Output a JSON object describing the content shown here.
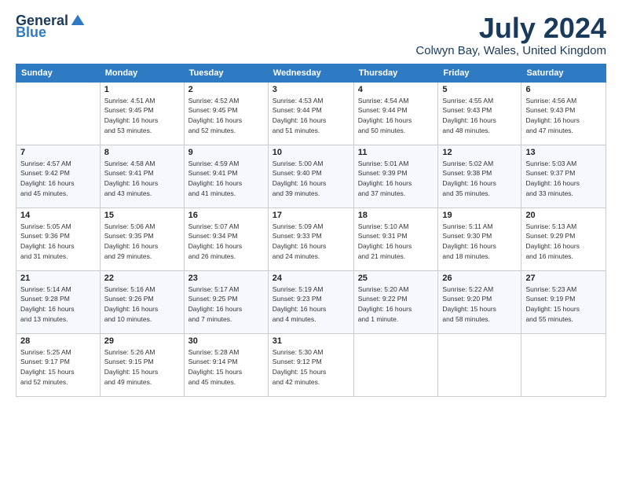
{
  "header": {
    "logo_general": "General",
    "logo_blue": "Blue",
    "month_year": "July 2024",
    "location": "Colwyn Bay, Wales, United Kingdom"
  },
  "days_of_week": [
    "Sunday",
    "Monday",
    "Tuesday",
    "Wednesday",
    "Thursday",
    "Friday",
    "Saturday"
  ],
  "weeks": [
    [
      {
        "day": "",
        "info": ""
      },
      {
        "day": "1",
        "info": "Sunrise: 4:51 AM\nSunset: 9:45 PM\nDaylight: 16 hours\nand 53 minutes."
      },
      {
        "day": "2",
        "info": "Sunrise: 4:52 AM\nSunset: 9:45 PM\nDaylight: 16 hours\nand 52 minutes."
      },
      {
        "day": "3",
        "info": "Sunrise: 4:53 AM\nSunset: 9:44 PM\nDaylight: 16 hours\nand 51 minutes."
      },
      {
        "day": "4",
        "info": "Sunrise: 4:54 AM\nSunset: 9:44 PM\nDaylight: 16 hours\nand 50 minutes."
      },
      {
        "day": "5",
        "info": "Sunrise: 4:55 AM\nSunset: 9:43 PM\nDaylight: 16 hours\nand 48 minutes."
      },
      {
        "day": "6",
        "info": "Sunrise: 4:56 AM\nSunset: 9:43 PM\nDaylight: 16 hours\nand 47 minutes."
      }
    ],
    [
      {
        "day": "7",
        "info": "Sunrise: 4:57 AM\nSunset: 9:42 PM\nDaylight: 16 hours\nand 45 minutes."
      },
      {
        "day": "8",
        "info": "Sunrise: 4:58 AM\nSunset: 9:41 PM\nDaylight: 16 hours\nand 43 minutes."
      },
      {
        "day": "9",
        "info": "Sunrise: 4:59 AM\nSunset: 9:41 PM\nDaylight: 16 hours\nand 41 minutes."
      },
      {
        "day": "10",
        "info": "Sunrise: 5:00 AM\nSunset: 9:40 PM\nDaylight: 16 hours\nand 39 minutes."
      },
      {
        "day": "11",
        "info": "Sunrise: 5:01 AM\nSunset: 9:39 PM\nDaylight: 16 hours\nand 37 minutes."
      },
      {
        "day": "12",
        "info": "Sunrise: 5:02 AM\nSunset: 9:38 PM\nDaylight: 16 hours\nand 35 minutes."
      },
      {
        "day": "13",
        "info": "Sunrise: 5:03 AM\nSunset: 9:37 PM\nDaylight: 16 hours\nand 33 minutes."
      }
    ],
    [
      {
        "day": "14",
        "info": "Sunrise: 5:05 AM\nSunset: 9:36 PM\nDaylight: 16 hours\nand 31 minutes."
      },
      {
        "day": "15",
        "info": "Sunrise: 5:06 AM\nSunset: 9:35 PM\nDaylight: 16 hours\nand 29 minutes."
      },
      {
        "day": "16",
        "info": "Sunrise: 5:07 AM\nSunset: 9:34 PM\nDaylight: 16 hours\nand 26 minutes."
      },
      {
        "day": "17",
        "info": "Sunrise: 5:09 AM\nSunset: 9:33 PM\nDaylight: 16 hours\nand 24 minutes."
      },
      {
        "day": "18",
        "info": "Sunrise: 5:10 AM\nSunset: 9:31 PM\nDaylight: 16 hours\nand 21 minutes."
      },
      {
        "day": "19",
        "info": "Sunrise: 5:11 AM\nSunset: 9:30 PM\nDaylight: 16 hours\nand 18 minutes."
      },
      {
        "day": "20",
        "info": "Sunrise: 5:13 AM\nSunset: 9:29 PM\nDaylight: 16 hours\nand 16 minutes."
      }
    ],
    [
      {
        "day": "21",
        "info": "Sunrise: 5:14 AM\nSunset: 9:28 PM\nDaylight: 16 hours\nand 13 minutes."
      },
      {
        "day": "22",
        "info": "Sunrise: 5:16 AM\nSunset: 9:26 PM\nDaylight: 16 hours\nand 10 minutes."
      },
      {
        "day": "23",
        "info": "Sunrise: 5:17 AM\nSunset: 9:25 PM\nDaylight: 16 hours\nand 7 minutes."
      },
      {
        "day": "24",
        "info": "Sunrise: 5:19 AM\nSunset: 9:23 PM\nDaylight: 16 hours\nand 4 minutes."
      },
      {
        "day": "25",
        "info": "Sunrise: 5:20 AM\nSunset: 9:22 PM\nDaylight: 16 hours\nand 1 minute."
      },
      {
        "day": "26",
        "info": "Sunrise: 5:22 AM\nSunset: 9:20 PM\nDaylight: 15 hours\nand 58 minutes."
      },
      {
        "day": "27",
        "info": "Sunrise: 5:23 AM\nSunset: 9:19 PM\nDaylight: 15 hours\nand 55 minutes."
      }
    ],
    [
      {
        "day": "28",
        "info": "Sunrise: 5:25 AM\nSunset: 9:17 PM\nDaylight: 15 hours\nand 52 minutes."
      },
      {
        "day": "29",
        "info": "Sunrise: 5:26 AM\nSunset: 9:15 PM\nDaylight: 15 hours\nand 49 minutes."
      },
      {
        "day": "30",
        "info": "Sunrise: 5:28 AM\nSunset: 9:14 PM\nDaylight: 15 hours\nand 45 minutes."
      },
      {
        "day": "31",
        "info": "Sunrise: 5:30 AM\nSunset: 9:12 PM\nDaylight: 15 hours\nand 42 minutes."
      },
      {
        "day": "",
        "info": ""
      },
      {
        "day": "",
        "info": ""
      },
      {
        "day": "",
        "info": ""
      }
    ]
  ]
}
